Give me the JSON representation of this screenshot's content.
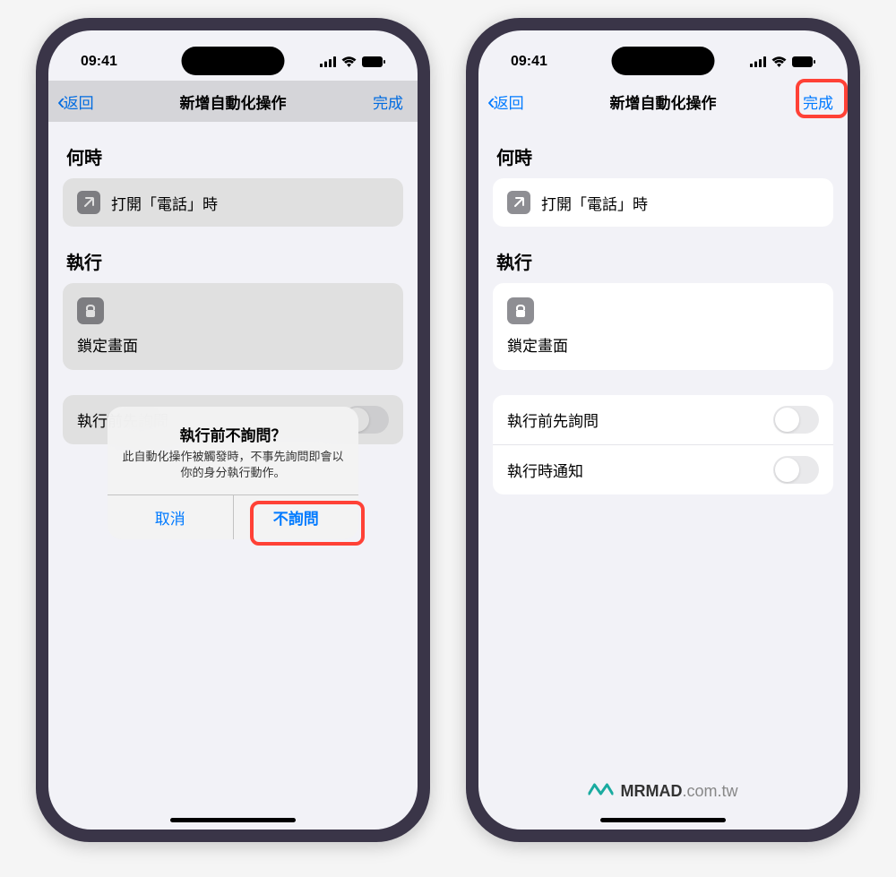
{
  "status": {
    "time": "09:41"
  },
  "nav": {
    "back": "返回",
    "title": "新增自動化操作",
    "done": "完成"
  },
  "sections": {
    "when": "何時",
    "do": "執行"
  },
  "trigger": {
    "label": "打開「電話」時"
  },
  "action": {
    "label": "鎖定畫面"
  },
  "settings": {
    "ask_before": "執行前先詢問",
    "notify": "執行時通知"
  },
  "alert": {
    "title": "執行前不詢問？",
    "message": "此自動化操作被觸發時，不事先詢問即會以你的身分執行動作。",
    "cancel": "取消",
    "confirm": "不詢問"
  },
  "watermark": {
    "brand": "MRMAD",
    "domain": ".com.tw"
  }
}
